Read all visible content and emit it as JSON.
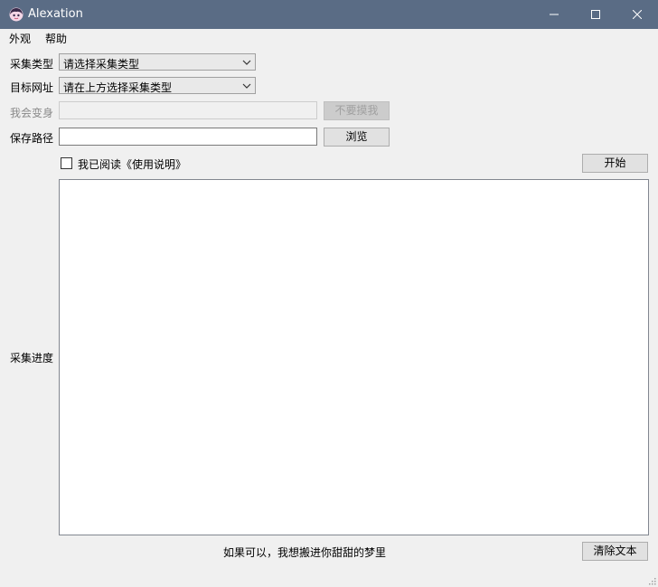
{
  "window": {
    "title": "Alexation"
  },
  "menu": {
    "items": [
      "外观",
      "帮助"
    ]
  },
  "form": {
    "type_label": "采集类型",
    "type_value": "请选择采集类型",
    "url_label": "目标网址",
    "url_value": "请在上方选择采集类型",
    "transform_label": "我会变身",
    "transform_value": "",
    "transform_button": "不要摸我",
    "path_label": "保存路径",
    "path_value": "",
    "browse_button": "浏览",
    "agree_label": "我已阅读《使用说明》",
    "agree_checked": false,
    "start_button": "开始",
    "progress_label": "采集进度",
    "progress_text": ""
  },
  "footer": {
    "message": "如果可以，我想搬进你甜甜的梦里",
    "clear_button": "清除文本"
  }
}
